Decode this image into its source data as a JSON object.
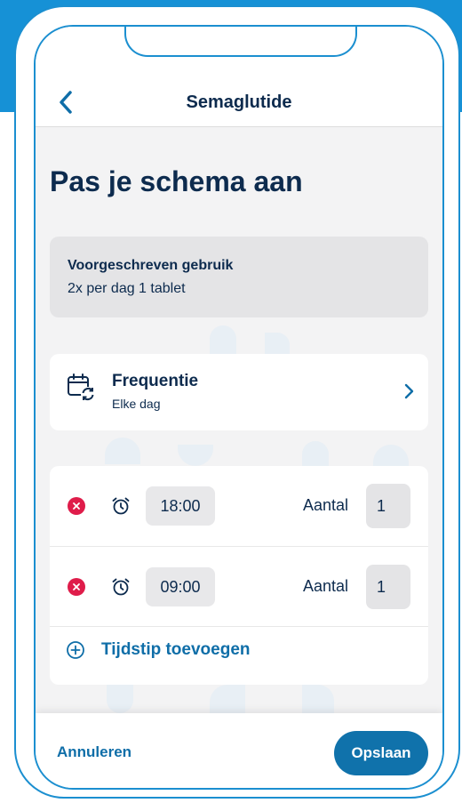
{
  "header": {
    "title": "Semaglutide",
    "back_icon": "chevron-left-icon"
  },
  "page": {
    "title": "Pas je schema aan"
  },
  "prescription": {
    "label": "Voorgeschreven gebruik",
    "value": "2x per dag 1 tablet"
  },
  "frequency": {
    "icon": "calendar-repeat-icon",
    "label": "Frequentie",
    "value": "Elke dag",
    "chevron_icon": "chevron-right-icon"
  },
  "times": [
    {
      "time": "18:00",
      "amount_label": "Aantal",
      "amount": "1"
    },
    {
      "time": "09:00",
      "amount_label": "Aantal",
      "amount": "1"
    }
  ],
  "add_time": {
    "label": "Tijdstip toevoegen",
    "icon": "plus-circle-icon"
  },
  "footer": {
    "cancel_label": "Annuleren",
    "save_label": "Opslaan"
  },
  "colors": {
    "accent": "#1691d6",
    "primary_button": "#1072ab",
    "link": "#0f6ea8",
    "remove": "#df1c4a",
    "text": "#0d2b4e",
    "background": "#f3f3f4"
  }
}
